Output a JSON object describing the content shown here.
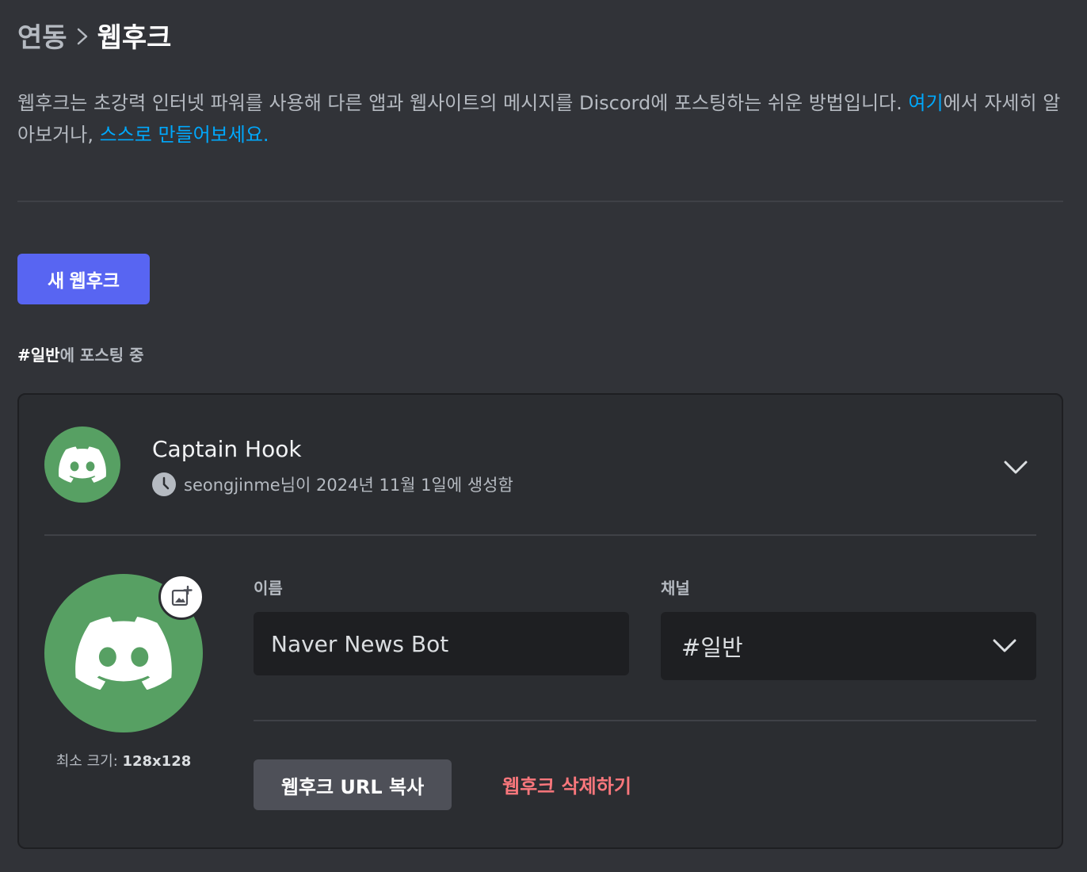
{
  "breadcrumb": {
    "parent": "연동",
    "current": "웹후크"
  },
  "description": {
    "text1": "웹후크는 초강력 인터넷 파워를 사용해 다른 앱과 웹사이트의 메시지를 Discord에 포스팅하는 쉬운 방법입니다. ",
    "link1": "여기",
    "text2": "에서 자세히 알아보거나, ",
    "link2": "스스로 만들어보세요."
  },
  "new_webhook_label": "새 웹후크",
  "posting": {
    "channel": "#일반",
    "suffix": "에 포스팅 중"
  },
  "webhook": {
    "name": "Captain Hook",
    "meta": "seongjinme님이 2024년 11월 1일에 생성함",
    "name_label": "이름",
    "name_value": "Naver News Bot",
    "channel_label": "채널",
    "channel_value": "#일반",
    "min_size_label": "최소 크기: ",
    "min_size_value": "128x128",
    "copy_label": "웹후크 URL 복사",
    "delete_label": "웹후크 삭제하기"
  },
  "colors": {
    "accent": "#5865f2",
    "avatar": "#57a063",
    "danger": "#fa777c",
    "link": "#00a8fc"
  },
  "icons": [
    "chevron-right-icon",
    "discord-logo-icon",
    "clock-icon",
    "chevron-down-icon",
    "add-image-icon"
  ]
}
